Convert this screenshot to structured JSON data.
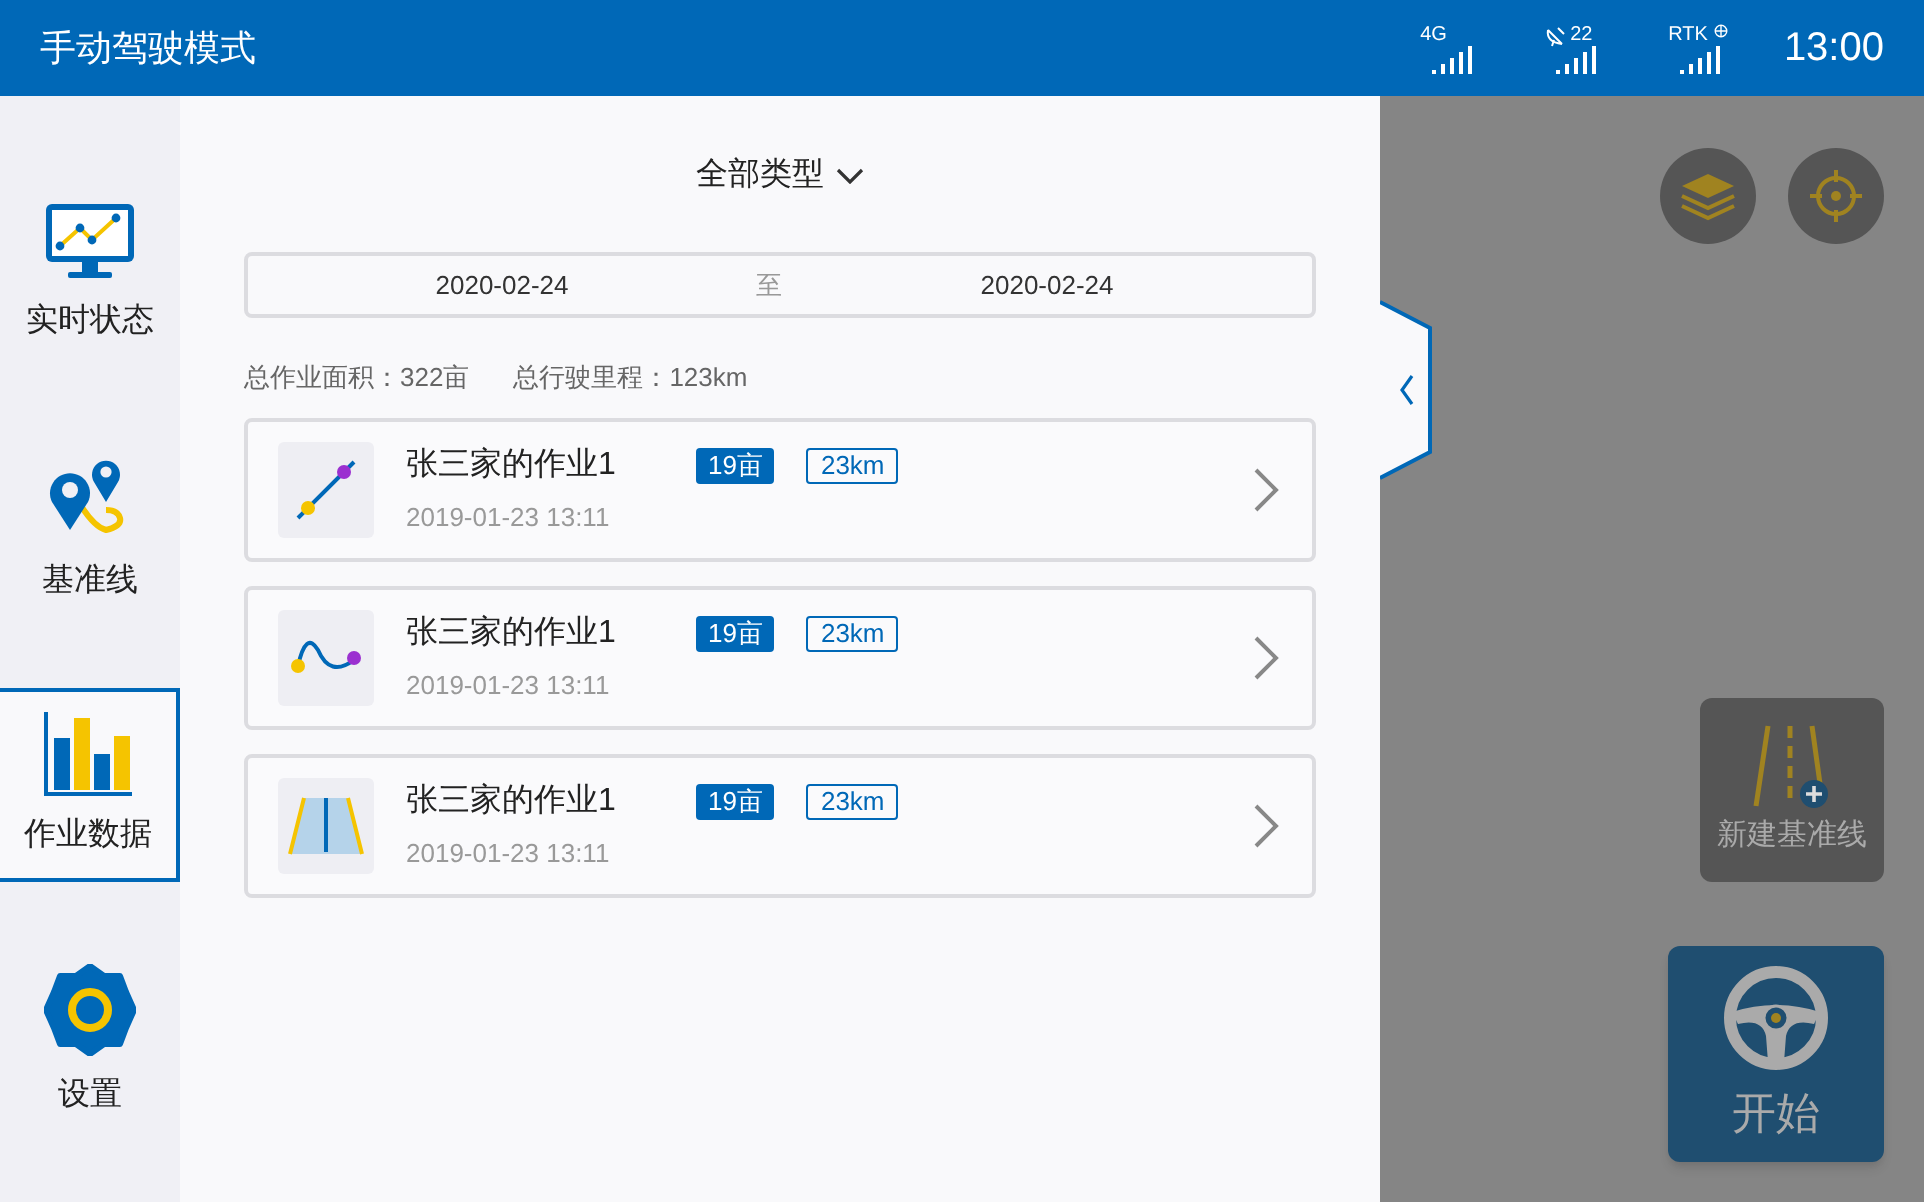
{
  "header": {
    "title": "手动驾驶模式",
    "status": [
      {
        "kind": "network",
        "label": "4G"
      },
      {
        "kind": "satellite",
        "label": "22"
      },
      {
        "kind": "rtk",
        "label": "RTK"
      }
    ],
    "time": "13:00"
  },
  "sidebar": {
    "items": [
      {
        "kind": "monitor",
        "label": "实时状态",
        "selected": false
      },
      {
        "kind": "pins",
        "label": "基准线",
        "selected": false
      },
      {
        "kind": "bars",
        "label": "作业数据",
        "selected": true
      },
      {
        "kind": "gear",
        "label": "设置",
        "selected": false
      }
    ]
  },
  "panel": {
    "filter": "全部类型",
    "date_from": "2020-02-24",
    "date_sep": "至",
    "date_to": "2020-02-24",
    "summary": [
      "总作业面积：322亩",
      "总行驶里程：123km"
    ],
    "records": [
      {
        "kind": "line",
        "title": "张三家的作业1",
        "area": "19亩",
        "distance": "23km",
        "time": "2019-01-23 13:11"
      },
      {
        "kind": "curve",
        "title": "张三家的作业1",
        "area": "19亩",
        "distance": "23km",
        "time": "2019-01-23 13:11"
      },
      {
        "kind": "road",
        "title": "张三家的作业1",
        "area": "19亩",
        "distance": "23km",
        "time": "2019-01-23 13:11"
      }
    ]
  },
  "map": {
    "new_baseline": "新建基准线",
    "start": "开始"
  }
}
